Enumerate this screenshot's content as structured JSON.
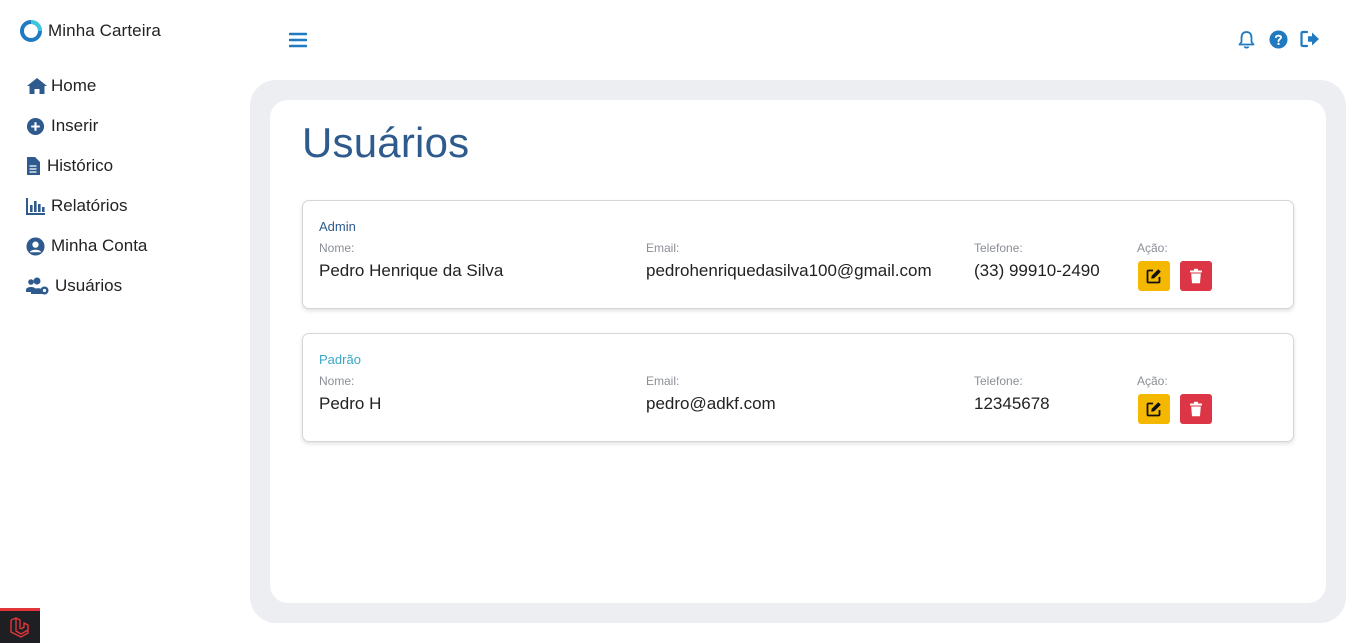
{
  "app": {
    "brand_name": "Minha Carteira"
  },
  "sidebar": {
    "items": [
      {
        "label": "Home",
        "icon": "home-icon"
      },
      {
        "label": "Inserir",
        "icon": "plus-circle-icon"
      },
      {
        "label": "Histórico",
        "icon": "file-icon"
      },
      {
        "label": "Relatórios",
        "icon": "bar-chart-icon"
      },
      {
        "label": "Minha Conta",
        "icon": "user-circle-icon"
      },
      {
        "label": "Usuários",
        "icon": "users-cog-icon"
      }
    ]
  },
  "topbar": {
    "icons": [
      "menu-icon",
      "bell-icon",
      "help-icon",
      "logout-icon"
    ]
  },
  "page": {
    "title": "Usuários"
  },
  "labels": {
    "name": "Nome:",
    "email": "Email:",
    "phone": "Telefone:",
    "action": "Ação:"
  },
  "users": [
    {
      "role": "Admin",
      "name": "Pedro Henrique da Silva",
      "email": "pedrohenriquedasilva100@gmail.com",
      "phone": "(33) 99910-2490"
    },
    {
      "role": "Padrão",
      "name": "Pedro H",
      "email": "pedro@adkf.com",
      "phone": "12345678"
    }
  ],
  "colors": {
    "primary": "#2e5a8e",
    "accent": "#1f7ac0",
    "edit": "#f5b800",
    "delete": "#dc3545",
    "padrao": "#3aa7c7"
  }
}
